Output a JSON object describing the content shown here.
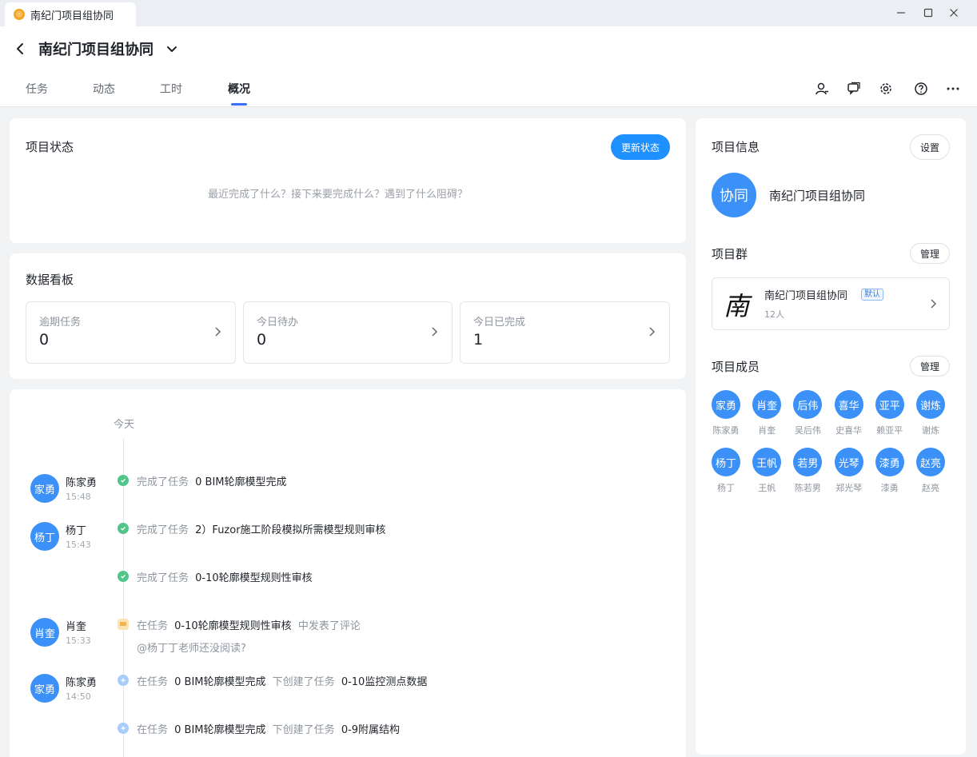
{
  "window": {
    "tab_title": "南纪门项目组协同",
    "tab_logo": "◎"
  },
  "header": {
    "title": "南纪门项目组协同",
    "tabs": [
      {
        "label": "任务"
      },
      {
        "label": "动态"
      },
      {
        "label": "工时"
      },
      {
        "label": "概况"
      }
    ],
    "active_tab": "概况",
    "icons": [
      "member-add-icon",
      "chat-icon",
      "gear-icon",
      "help-icon",
      "more-icon"
    ]
  },
  "status_card": {
    "title": "项目状态",
    "update_button": "更新状态",
    "placeholder": "最近完成了什么？接下来要完成什么？遇到了什么阻碍？"
  },
  "dashboard": {
    "title": "数据看板",
    "stats": [
      {
        "label": "逾期任务",
        "value": "0"
      },
      {
        "label": "今日待办",
        "value": "0"
      },
      {
        "label": "今日已完成",
        "value": "1"
      }
    ]
  },
  "timeline": {
    "day_label": "今天",
    "entries": [
      {
        "avatar": "家勇",
        "name": "陈家勇",
        "time": "15:48",
        "type": "complete",
        "prefix": "完成了任务",
        "task": "0 BIM轮廓模型完成"
      },
      {
        "avatar": "杨丁",
        "name": "杨丁",
        "time": "15:43",
        "type": "complete",
        "prefix": "完成了任务",
        "task": "2）Fuzor施工阶段模拟所需模型规则审核"
      },
      {
        "type": "complete",
        "prefix": "完成了任务",
        "task": "0-10轮廓模型规则性审核"
      },
      {
        "avatar": "肖奎",
        "name": "肖奎",
        "time": "15:33",
        "type": "comment",
        "prefix": "在任务",
        "task": "0-10轮廓模型规则性审核",
        "suffix": "中发表了评论",
        "comment": "@杨丁丁老师还没阅读?"
      },
      {
        "avatar": "家勇",
        "name": "陈家勇",
        "time": "14:50",
        "type": "create",
        "prefix": "在任务",
        "task": "0 BIM轮廓模型完成",
        "suffix": "下创建了任务",
        "task2": "0-10监控测点数据"
      },
      {
        "type": "create",
        "prefix": "在任务",
        "task": "0 BIM轮廓模型完成",
        "suffix": "下创建了任务",
        "task2": "0-9附属结构"
      }
    ]
  },
  "project_info": {
    "title": "项目信息",
    "settings_button": "设置",
    "avatar_text": "协同",
    "name": "南纪门项目组协同"
  },
  "project_group": {
    "title": "项目群",
    "manage_button": "管理",
    "logo_char": "南",
    "name": "南纪门项目组协同",
    "badge": "默认",
    "count": "12人"
  },
  "members": {
    "title": "项目成员",
    "manage_button": "管理",
    "list": [
      {
        "avatar": "家勇",
        "name": "陈家勇"
      },
      {
        "avatar": "肖奎",
        "name": "肖奎"
      },
      {
        "avatar": "后伟",
        "name": "吴后伟"
      },
      {
        "avatar": "喜华",
        "name": "史喜华"
      },
      {
        "avatar": "亚平",
        "name": "赖亚平"
      },
      {
        "avatar": "谢炼",
        "name": "谢炼"
      },
      {
        "avatar": "杨丁",
        "name": "杨丁"
      },
      {
        "avatar": "王帆",
        "name": "王帆"
      },
      {
        "avatar": "若男",
        "name": "陈若男"
      },
      {
        "avatar": "光琴",
        "name": "郑光琴"
      },
      {
        "avatar": "漆勇",
        "name": "漆勇"
      },
      {
        "avatar": "赵亮",
        "name": "赵亮"
      }
    ]
  },
  "colors": {
    "accent": "#1e90ff",
    "avatar": "#3b91f7",
    "complete": "#52c48a",
    "comment": "#f5b34a",
    "create": "#5a9cf5"
  }
}
